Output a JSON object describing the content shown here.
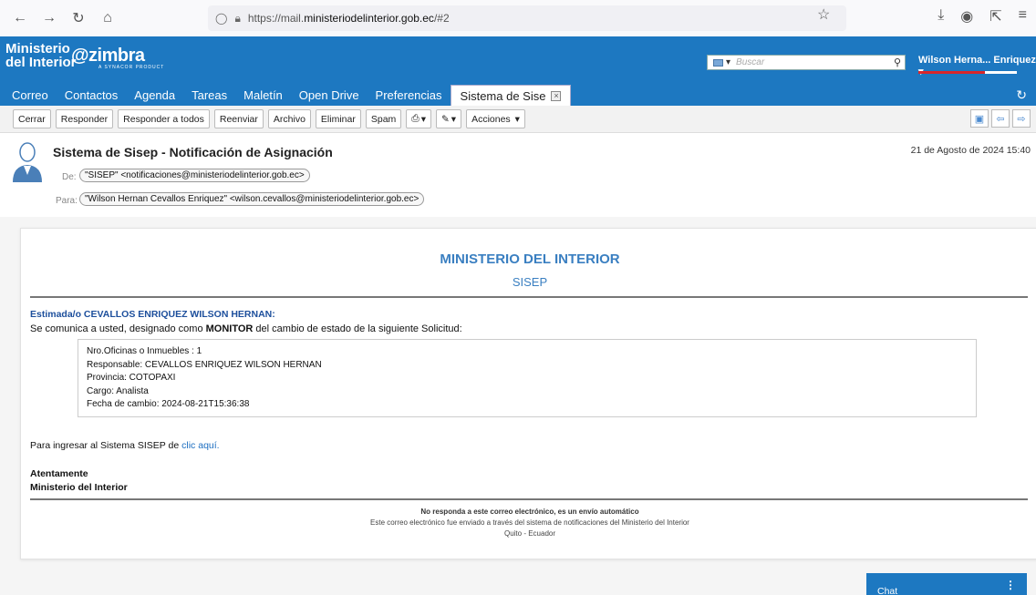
{
  "browser": {
    "url_prefix": "https://mail.",
    "url_domain": "ministeriodelinterior.gob.ec",
    "url_suffix": "/#2"
  },
  "header": {
    "org_line1": "Ministerio",
    "org_line2": "del Interior",
    "brand": "zimbra",
    "brand_tagline": "A SYNACOR PRODUCT",
    "search_placeholder": "Buscar",
    "user_name": "Wilson Herna... Enriquez"
  },
  "tabs": [
    {
      "label": "Correo"
    },
    {
      "label": "Contactos"
    },
    {
      "label": "Agenda"
    },
    {
      "label": "Tareas"
    },
    {
      "label": "Maletín"
    },
    {
      "label": "Open Drive"
    },
    {
      "label": "Preferencias"
    },
    {
      "label": "Sistema de Sise"
    }
  ],
  "toolbar": {
    "close": "Cerrar",
    "reply": "Responder",
    "reply_all": "Responder a todos",
    "forward": "Reenviar",
    "archive": "Archivo",
    "delete": "Eliminar",
    "spam": "Spam",
    "actions": "Acciones"
  },
  "message": {
    "subject": "Sistema de Sisep - Notificación de Asignación",
    "date": "21 de Agosto de 2024 15:40",
    "from_label": "De:",
    "from": "\"SISEP\" <notificaciones@ministeriodelinterior.gob.ec>",
    "to_label": "Para:",
    "to": "\"Wilson Hernan Cevallos Enriquez\" <wilson.cevallos@ministeriodelinterior.gob.ec>"
  },
  "email": {
    "title": "MINISTERIO DEL INTERIOR",
    "subtitle": "SISEP",
    "greeting": "Estimada/o CEVALLOS ENRIQUEZ WILSON HERNAN:",
    "para_before": "Se comunica a usted, designado como ",
    "para_bold": "MONITOR",
    "para_after": " del cambio de estado de la siguiente Solicitud:",
    "details": [
      "Nro.Oficinas o Inmuebles : 1",
      "Responsable: CEVALLOS ENRIQUEZ WILSON HERNAN",
      "Provincia: COTOPAXI",
      "Cargo: Analista",
      "Fecha de cambio: 2024-08-21T15:36:38"
    ],
    "link_text_before": "Para ingresar al Sistema SISEP de ",
    "link_text": "clic aquí.",
    "sign1": "Atentamente",
    "sign2": "Ministerio del Interior",
    "footer_bold": "No responda a este correo electrónico, es un envío automático",
    "footer1": "Este correo electrónico fue enviado a través del sistema de notificaciones del Ministerio del Interior",
    "footer2": "Quito - Ecuador"
  },
  "chat": {
    "label": "Chat"
  }
}
